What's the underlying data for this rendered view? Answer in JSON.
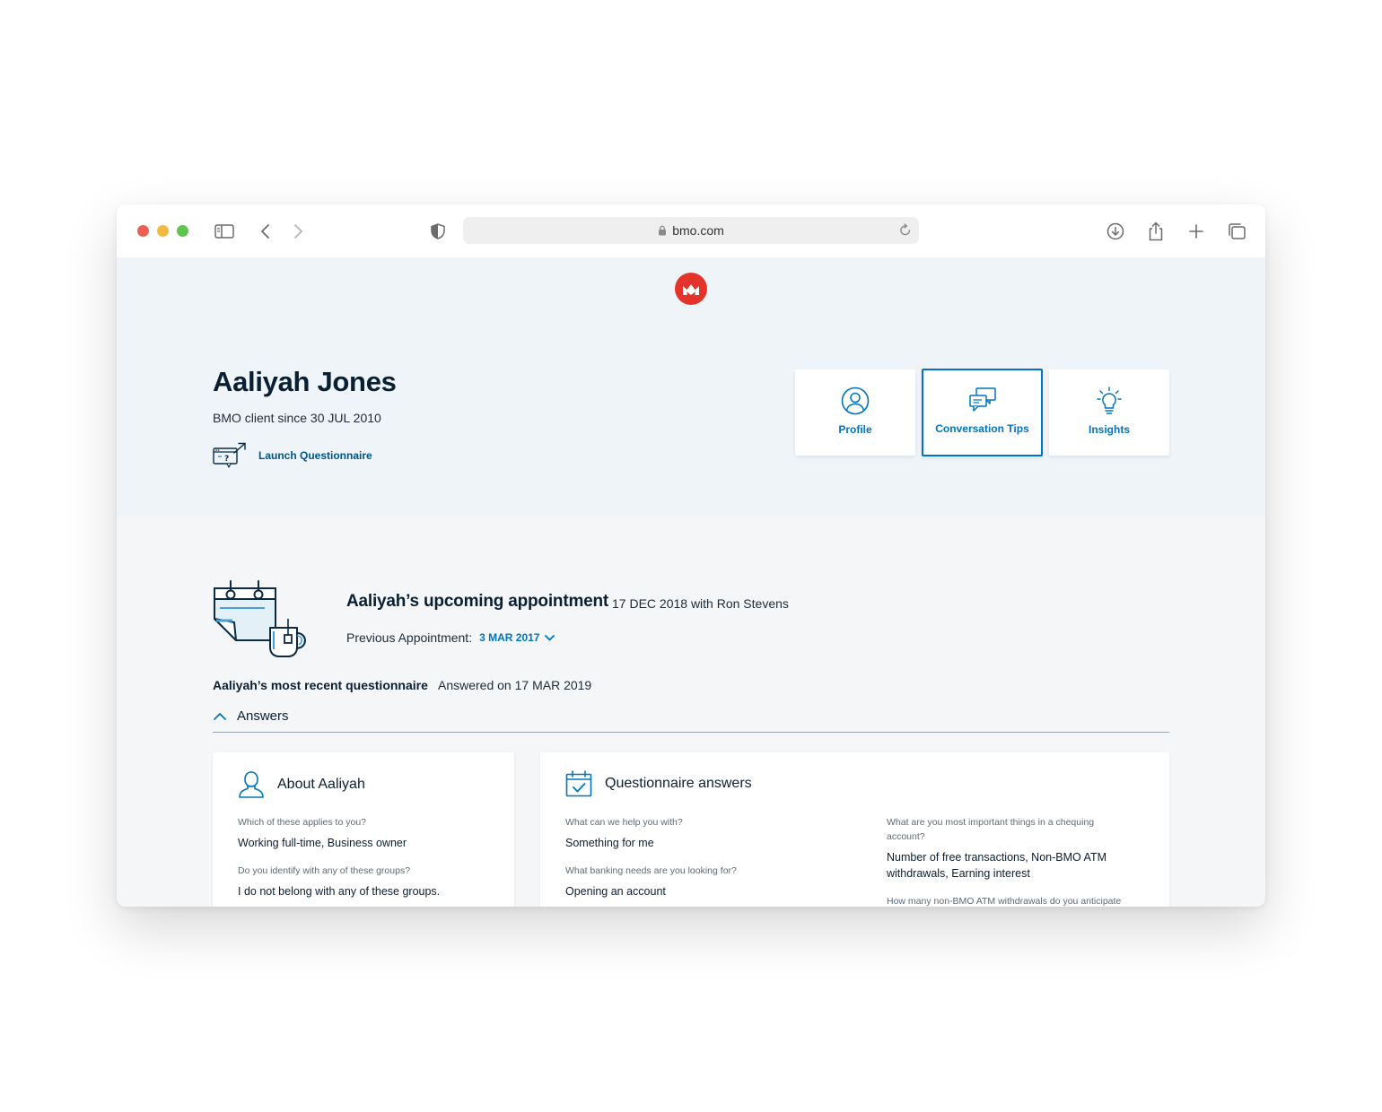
{
  "browser": {
    "url": "bmo.com"
  },
  "client": {
    "name": "Aaliyah Jones",
    "since": "BMO client since 30 JUL 2010",
    "launch_label": "Launch Questionnaire"
  },
  "nav_cards": [
    {
      "label": "Profile",
      "icon": "user-circle-icon",
      "active": false
    },
    {
      "label": "Conversation Tips",
      "icon": "chat-bubbles-icon",
      "active": true
    },
    {
      "label": "Insights",
      "icon": "lightbulb-icon",
      "active": false
    }
  ],
  "appointment": {
    "title": "Aaliyah’s upcoming appointment",
    "detail": "17 DEC 2018 with Ron Stevens",
    "previous_label": "Previous Appointment:",
    "previous_value": "3 MAR 2017"
  },
  "questionnaire": {
    "title": "Aaliyah’s most recent questionnaire",
    "answered": "Answered on 17 MAR 2019",
    "toggle_label": "Answers"
  },
  "about": {
    "title": "About Aaliyah",
    "items": [
      {
        "q": "Which of these applies to you?",
        "a": "Working full-time, Business owner"
      },
      {
        "q": "Do you identify with any of these groups?",
        "a": "I do not belong with any of these groups."
      }
    ]
  },
  "answers": {
    "title": "Questionnaire answers",
    "left": [
      {
        "q": "What can we help you with?",
        "a": "Something for me"
      },
      {
        "q": "What banking needs are you looking for?",
        "a": "Opening an account"
      }
    ],
    "right": [
      {
        "q": "What are you most important things in a chequing account?",
        "a": "Number of free transactions, Non-BMO ATM withdrawals, Earning interest"
      },
      {
        "q": "How many non-BMO ATM withdrawals do you anticipate",
        "a": ""
      }
    ]
  },
  "colors": {
    "brand_red": "#e4332a",
    "accent_blue": "#0075be",
    "hero_bg": "#eef4f8"
  }
}
